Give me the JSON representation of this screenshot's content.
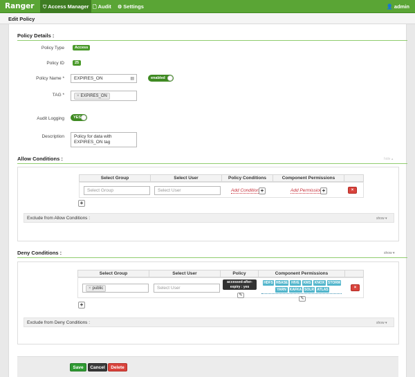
{
  "nav": {
    "brand": "Ranger",
    "items": [
      {
        "label": "Access Manager",
        "icon": "shield-icon",
        "glyph": "⛉"
      },
      {
        "label": "Audit",
        "icon": "file-icon",
        "glyph": "🗋"
      },
      {
        "label": "Settings",
        "icon": "gear-icon",
        "glyph": "⚙"
      }
    ],
    "user": "admin",
    "user_glyph": "👤"
  },
  "page": {
    "title": "Edit Policy"
  },
  "policy": {
    "section_title": "Policy Details :",
    "type_label": "Policy Type",
    "type_value": "Access",
    "id_label": "Policy ID",
    "id_value": "25",
    "name_label": "Policy Name *",
    "name_value": "EXPIRES_ON",
    "enabled_label": "enabled",
    "tag_label": "TAG *",
    "tag_value": "EXPIRES_ON",
    "audit_label": "Audit Logging",
    "audit_value": "YES",
    "desc_label": "Description",
    "desc_value": "Policy for data with EXPIRES_ON tag"
  },
  "allow": {
    "section_title": "Allow Conditions :",
    "hide": "hide ▴",
    "headers": [
      "Select Group",
      "Select User",
      "Policy Conditions",
      "Component Permissions"
    ],
    "group_placeholder": "Select Group",
    "user_placeholder": "Select User",
    "add_conditions": "Add Conditions",
    "add_permissions": "Add Permissions",
    "exclude_label": "Exclude from Allow Conditions :",
    "show": "show ▾"
  },
  "deny": {
    "section_title": "Deny Conditions :",
    "show_top": "show ▾",
    "headers": [
      "Select Group",
      "Select User",
      "Policy Conditions",
      "Component Permissions"
    ],
    "group_value": "public",
    "user_placeholder": "Select User",
    "condition": "accessed-after-expiry : yes",
    "permissions_row1": [
      "HDFS",
      "HBASE",
      "HIVE",
      "KMS",
      "KNOX",
      "STORM"
    ],
    "permissions_row2": [
      "YARN",
      "KAFKA",
      "SOLR",
      "ATLAS"
    ],
    "exclude_label": "Exclude from Deny Conditions :",
    "show": "show ▾"
  },
  "footer": {
    "save": "Save",
    "cancel": "Cancel",
    "delete": "Delete"
  },
  "colors": {
    "nav_green": "#5aa535",
    "save_green": "#2f9a32",
    "cancel_dark": "#3a3a3a",
    "delete_red": "#d9443d",
    "permission_teal": "#53b6cc"
  }
}
